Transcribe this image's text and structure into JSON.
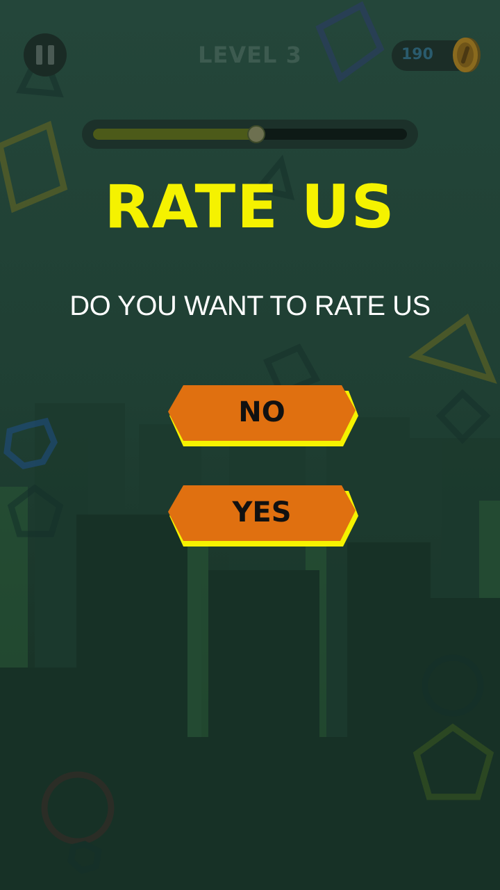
{
  "hud": {
    "pause_icon": "pause-icon",
    "level_label": "LEVEL 3",
    "coin_count": "190",
    "coin_icon": "coin-icon",
    "level_progress": 0.52
  },
  "dialog": {
    "title": "RATE US",
    "question": "DO YOU WANT TO RATE US",
    "no_label": "NO",
    "yes_label": "YES"
  },
  "colors": {
    "title": "#f5f200",
    "button_fill": "#e07010",
    "button_edge": "#f5f200",
    "background": "#1f3f33"
  }
}
